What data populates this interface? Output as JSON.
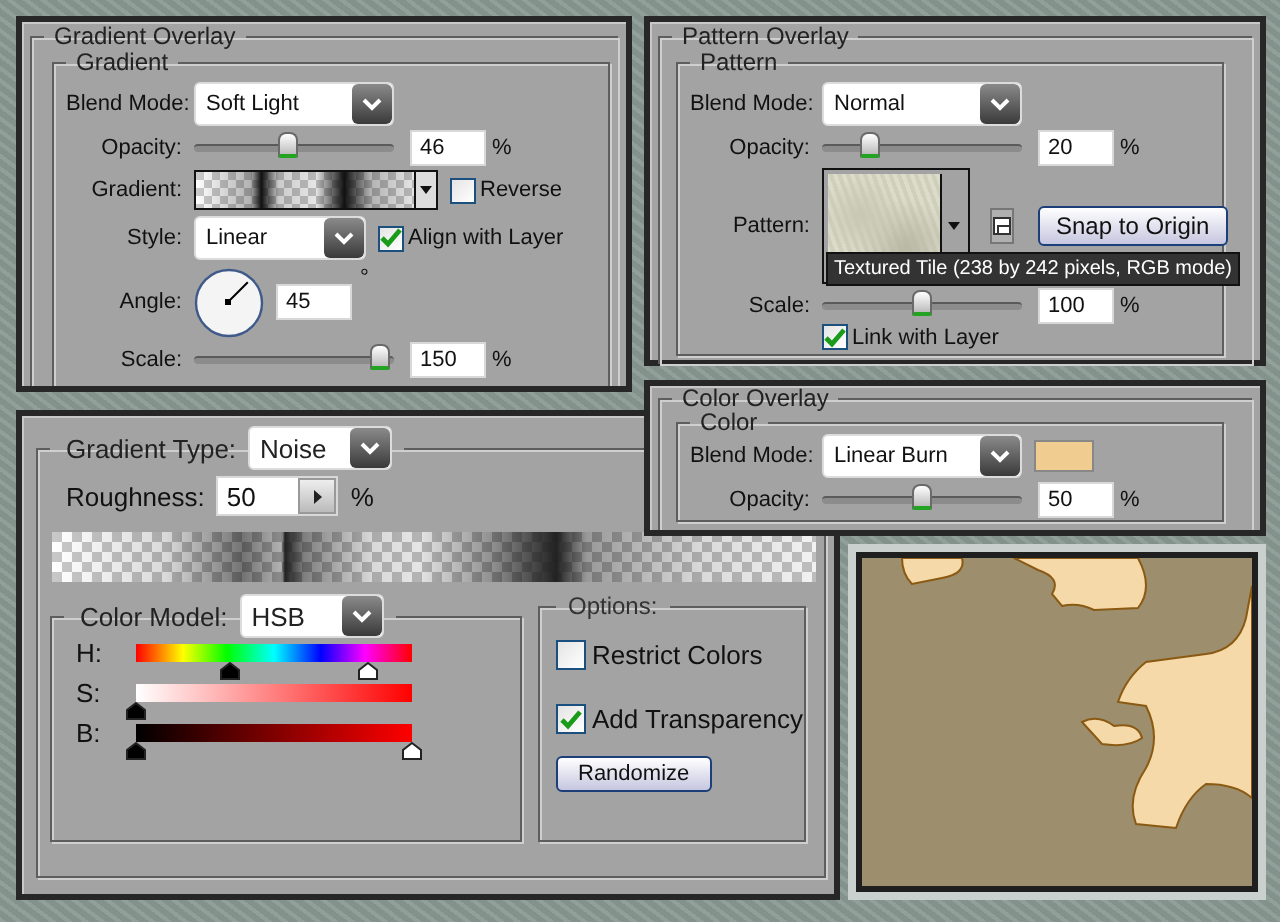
{
  "gradient_overlay": {
    "title": "Gradient Overlay",
    "group_title": "Gradient",
    "blend_mode": {
      "label": "Blend Mode:",
      "value": "Soft Light"
    },
    "opacity": {
      "label": "Opacity:",
      "value": "46",
      "unit": "%",
      "level": 0.46
    },
    "gradient": {
      "label": "Gradient:"
    },
    "reverse": {
      "label": "Reverse",
      "checked": false
    },
    "style": {
      "label": "Style:",
      "value": "Linear"
    },
    "align_with_layer": {
      "label": "Align with Layer",
      "checked": true
    },
    "angle": {
      "label": "Angle:",
      "value": "45",
      "unit": "°"
    },
    "scale": {
      "label": "Scale:",
      "value": "150",
      "unit": "%",
      "level": 1.0
    }
  },
  "pattern_overlay": {
    "title": "Pattern Overlay",
    "group_title": "Pattern",
    "blend_mode": {
      "label": "Blend Mode:",
      "value": "Normal"
    },
    "opacity": {
      "label": "Opacity:",
      "value": "20",
      "unit": "%",
      "level": 0.2
    },
    "pattern": {
      "label": "Pattern:"
    },
    "snap_button": "Snap to Origin",
    "tooltip": "Textured Tile (238 by 242 pixels, RGB mode)",
    "scale": {
      "label": "Scale:",
      "value": "100",
      "unit": "%",
      "level": 0.5
    },
    "link_with_layer": {
      "label": "Link with Layer",
      "checked": true
    }
  },
  "color_overlay": {
    "title": "Color Overlay",
    "group_title": "Color",
    "blend_mode": {
      "label": "Blend Mode:",
      "value": "Linear Burn"
    },
    "swatch": {
      "color": "#f0cc90"
    },
    "opacity": {
      "label": "Opacity:",
      "value": "50",
      "unit": "%",
      "level": 0.5
    }
  },
  "gradient_editor": {
    "gradient_type": {
      "label": "Gradient Type:",
      "value": "Noise"
    },
    "roughness": {
      "label": "Roughness:",
      "value": "50",
      "unit": "%"
    },
    "color_model": {
      "label": "Color Model:",
      "value": "HSB"
    },
    "channels": [
      {
        "label": "H:",
        "kind": "hue",
        "stops": [
          {
            "kind": "min",
            "level": 0.34
          },
          {
            "kind": "max",
            "level": 0.84
          }
        ]
      },
      {
        "label": "S:",
        "kind": "saturation",
        "stops": [
          {
            "kind": "min",
            "level": 0
          }
        ]
      },
      {
        "label": "B:",
        "kind": "brightness",
        "stops": [
          {
            "kind": "min",
            "level": 0
          },
          {
            "kind": "max",
            "level": 1
          }
        ]
      }
    ],
    "options": {
      "title": "Options:",
      "restrict_colors": {
        "label": "Restrict Colors",
        "checked": false
      },
      "add_transparency": {
        "label": "Add Transparency",
        "checked": true
      },
      "randomize_button": "Randomize"
    }
  }
}
